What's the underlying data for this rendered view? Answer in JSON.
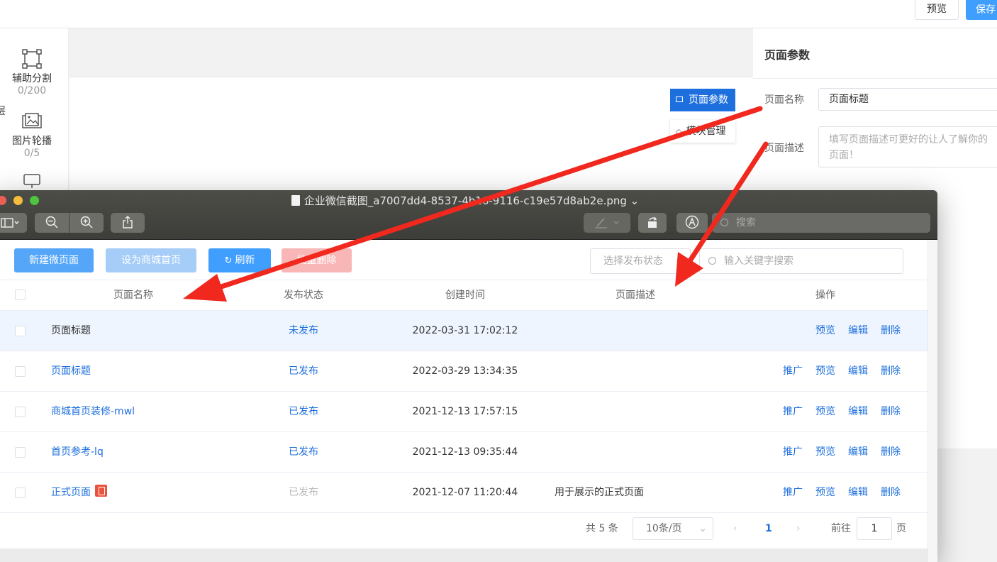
{
  "editor": {
    "topbar": {
      "preview_label": "预览",
      "save_label": "保存"
    },
    "left_edge_char": "层",
    "components": [
      {
        "name": "辅助分割",
        "count": "0/200",
        "icon": "divider-icon"
      },
      {
        "name": "图片轮播",
        "count": "0/5",
        "icon": "image-carousel-icon"
      }
    ],
    "canvas_tabs": {
      "params": "页面参数",
      "modules": "模块管理"
    },
    "right_panel": {
      "title": "页面参数",
      "name_label": "页面名称",
      "name_value": "页面标题",
      "desc_label": "页面描述",
      "desc_placeholder": "填写页面描述可更好的让人了解你的页面！"
    }
  },
  "window": {
    "title": "企业微信截图_a7007dd4-8537-4b16-9116-c19e57d8ab2e.png",
    "search_placeholder": "搜索",
    "toolbar": {
      "new_page": "新建微页面",
      "set_home": "设为商城首页",
      "refresh": "刷新",
      "batch_delete": "批量删除",
      "status_select": "选择发布状态",
      "keyword_placeholder": "输入关键字搜索"
    },
    "table": {
      "headers": [
        "页面名称",
        "发布状态",
        "创建时间",
        "页面描述",
        "操作"
      ],
      "rows": [
        {
          "name": "页面标题",
          "status": "未发布",
          "time": "2022-03-31 17:02:12",
          "desc": "",
          "ops": [
            "预览",
            "编辑",
            "删除"
          ]
        },
        {
          "name": "页面标题",
          "status": "已发布",
          "time": "2022-03-29 13:34:35",
          "desc": "",
          "ops": [
            "推广",
            "预览",
            "编辑",
            "删除"
          ]
        },
        {
          "name": "商城首页装修-mwl",
          "status": "已发布",
          "time": "2021-12-13 17:57:15",
          "desc": "",
          "ops": [
            "推广",
            "预览",
            "编辑",
            "删除"
          ]
        },
        {
          "name": "首页参考-lq",
          "status": "已发布",
          "time": "2021-12-13 09:35:44",
          "desc": "",
          "ops": [
            "推广",
            "预览",
            "编辑",
            "删除"
          ]
        },
        {
          "name": "正式页面",
          "status": "已发布",
          "time": "2021-12-07 11:20:44",
          "desc": "用于展示的正式页面",
          "ops": [
            "推广",
            "预览",
            "编辑",
            "删除"
          ]
        }
      ]
    },
    "pagination": {
      "total": "共 5 条",
      "page_size": "10条/页",
      "current_page": "1",
      "goto_label": "前往",
      "goto_value": "1",
      "page_suffix": "页"
    }
  },
  "colors": {
    "primary": "#409eff",
    "link": "#1e6fde",
    "arrow": "#f0281e",
    "danger_tag": "#e9533d"
  }
}
